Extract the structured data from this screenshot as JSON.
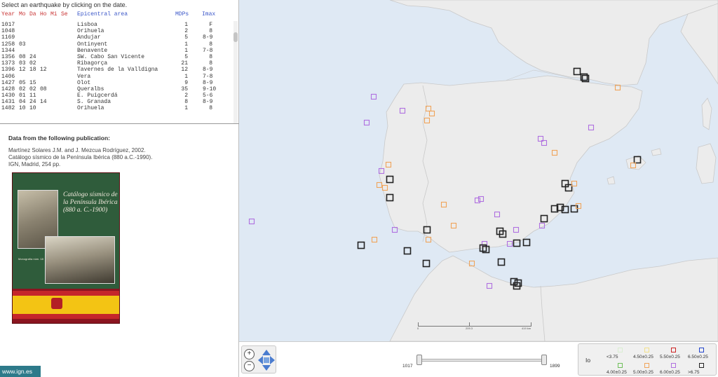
{
  "instruction": "Select an earthquake by clicking on the date.",
  "table": {
    "headers": [
      "Year",
      "Mo",
      "Da",
      "Ho",
      "Mi",
      "Se",
      "Epicentral area",
      "MDPs",
      "Imax"
    ],
    "rows": [
      [
        "1017",
        "",
        "",
        "",
        "",
        "",
        "Lisboa",
        "1",
        "F"
      ],
      [
        "1048",
        "",
        "",
        "",
        "",
        "",
        "Orihuela",
        "2",
        "8"
      ],
      [
        "1169",
        "",
        "",
        "",
        "",
        "",
        "Andujar",
        "5",
        "8-9"
      ],
      [
        "1258",
        "03",
        "",
        "",
        "",
        "",
        "Ontinyent",
        "1",
        "8"
      ],
      [
        "1344",
        "",
        "",
        "",
        "",
        "",
        "Benavente",
        "1",
        "7-8"
      ],
      [
        "1356",
        "08",
        "24",
        "",
        "",
        "",
        "SW. Cabo San Vicente",
        "5",
        "8"
      ],
      [
        "1373",
        "03",
        "02",
        "",
        "",
        "",
        "Ribagorça",
        "21",
        "8"
      ],
      [
        "1396",
        "12",
        "18",
        "12",
        "",
        "",
        "Tavernes de la Valldigna",
        "12",
        "8-9"
      ],
      [
        "1406",
        "",
        "",
        "",
        "",
        "",
        "Vera",
        "1",
        "7-8"
      ],
      [
        "1427",
        "05",
        "15",
        "",
        "",
        "",
        "Olot",
        "9",
        "8-9"
      ],
      [
        "1428",
        "02",
        "02",
        "08",
        "",
        "",
        "Queralbs",
        "35",
        "9-10"
      ],
      [
        "1430",
        "01",
        "11",
        "",
        "",
        "",
        "E. Puigcerdá",
        "2",
        "5-6"
      ],
      [
        "1431",
        "04",
        "24",
        "14",
        "",
        "",
        "S. Granada",
        "8",
        "8-9"
      ],
      [
        "1482",
        "10",
        "10",
        "",
        "",
        "",
        "Orihuela",
        "1",
        "8"
      ]
    ]
  },
  "publication": {
    "heading": "Data from the following publication:",
    "lines": [
      "Martínez Solares J.M. and J. Mezcua Rodríguez, 2002.",
      "Catálogo sísmico de la Península Ibérica (880 a.C.-1990).",
      "IGN, Madrid, 254 pp."
    ],
    "cover_title": "Catálogo sísmico de la Península Ibérica (880 a. C.-1900)",
    "cover_series": "Monografía núm. 18"
  },
  "footer": {
    "brand": "www.ign.es"
  },
  "map": {
    "scale_labels": [
      "0",
      "209.3",
      "419 km"
    ]
  },
  "time_slider": {
    "min": "1017",
    "max": "1899",
    "range": [
      1017,
      1899
    ]
  },
  "legend": {
    "title": "Io",
    "items": [
      {
        "label": "<3.75",
        "color": "#d9eed1"
      },
      {
        "label": "4.00±0.25",
        "color": "#6fbf5a"
      },
      {
        "label": "4.50±0.25",
        "color": "#f2e08a"
      },
      {
        "label": "5.00±0.25",
        "color": "#f0a45a"
      },
      {
        "label": "5.50±0.25",
        "color": "#cc2222"
      },
      {
        "label": "6.00±0.25",
        "color": "#b070e0"
      },
      {
        "label": "6.50±0.25",
        "color": "#2244cc"
      },
      {
        "label": ">6.75",
        "color": "#222222"
      }
    ]
  },
  "colors": {
    "sea": "#dfe9f4",
    "land": "#ececec",
    "brand": "#2d7a8a"
  }
}
